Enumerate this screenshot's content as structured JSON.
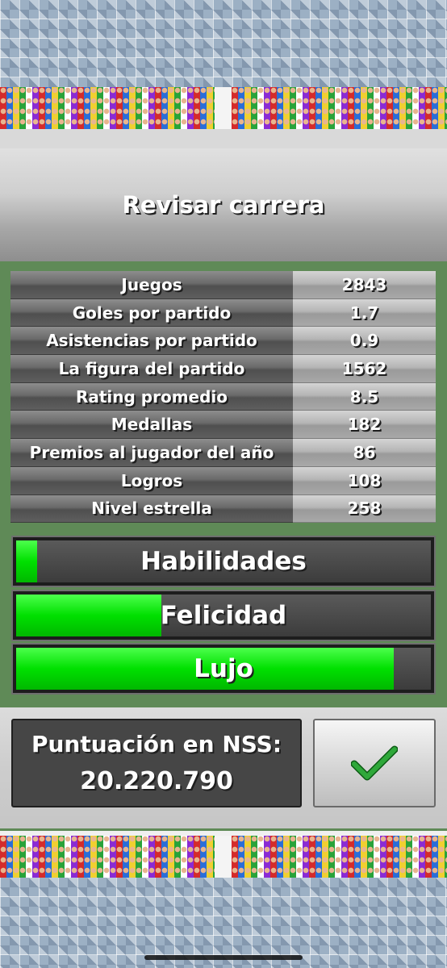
{
  "header": {
    "title": "Revisar carrera"
  },
  "stats": [
    {
      "label": "Juegos",
      "value": "2843"
    },
    {
      "label": "Goles por partido",
      "value": "1.7"
    },
    {
      "label": "Asistencias por partido",
      "value": "0.9"
    },
    {
      "label": "La figura del partido",
      "value": "1562"
    },
    {
      "label": "Rating promedio",
      "value": "8.5"
    },
    {
      "label": "Medallas",
      "value": "182"
    },
    {
      "label": "Premios al jugador del año",
      "value": "86"
    },
    {
      "label": "Logros",
      "value": "108"
    },
    {
      "label": "Nivel estrella",
      "value": "258"
    }
  ],
  "bars": [
    {
      "label": "Habilidades",
      "level": 0.05
    },
    {
      "label": "Felicidad",
      "level": 0.35
    },
    {
      "label": "Lujo",
      "level": 0.91
    }
  ],
  "score": {
    "title": "Puntuación en NSS:",
    "value": "20.220.790"
  },
  "confirm": {
    "icon": "checkmark-icon",
    "color": "#2fa83a"
  },
  "colors": {
    "bar_fill": "#00e000",
    "pitch": "#5f8a57"
  }
}
